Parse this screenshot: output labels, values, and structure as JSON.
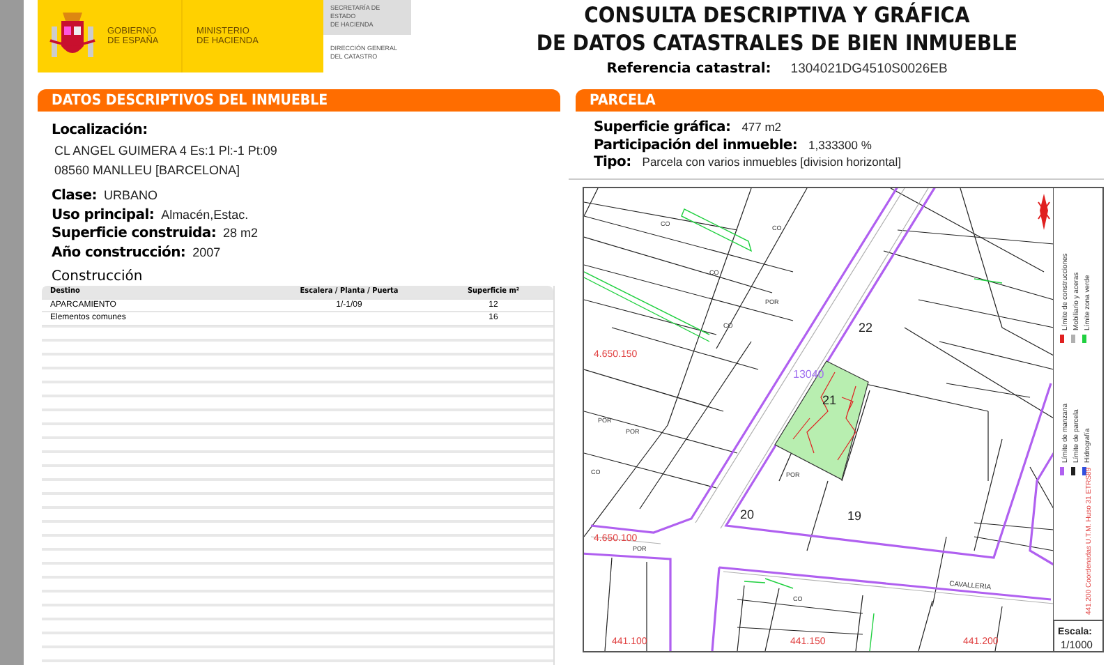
{
  "header": {
    "government_lines": [
      "GOBIERNO",
      "DE ESPAÑA"
    ],
    "ministry_lines": [
      "MINISTERIO",
      "DE HACIENDA"
    ],
    "secretariat_lines": [
      "SECRETARÍA DE ESTADO",
      "DE HACIENDA"
    ],
    "directorate_lines": [
      "DIRECCIÓN GENERAL",
      "DEL CATASTRO"
    ],
    "title_lines": [
      "CONSULTA DESCRIPTIVA Y GRÁFICA",
      "DE DATOS CATASTRALES DE BIEN INMUEBLE"
    ],
    "reference": {
      "label": "Referencia catastral:",
      "value": "1304021DG4510S0026EB"
    }
  },
  "property": {
    "title": "DATOS DESCRIPTIVOS DEL INMUEBLE",
    "location_label": "Localización:",
    "address_lines": [
      "CL ANGEL GUIMERA 4 Es:1 Pl:-1 Pt:09",
      "08560 MANLLEU [BARCELONA]"
    ],
    "fields": [
      {
        "label": "Clase:",
        "value": "URBANO"
      },
      {
        "label": "Uso principal:",
        "value": "Almacén,Estac."
      },
      {
        "label": "Superficie construida:",
        "value": "28 m2"
      },
      {
        "label": "Año construcción:",
        "value": "2007"
      }
    ],
    "construction": {
      "title": "Construcción",
      "columns": [
        "Destino",
        "Escalera / Planta / Puerta",
        "Superficie m²"
      ],
      "rows": [
        [
          "APARCAMIENTO",
          "1/-1/09",
          "12"
        ],
        [
          "Elementos comunes",
          "",
          "16"
        ]
      ]
    }
  },
  "parcel": {
    "title": "PARCELA",
    "fields": [
      {
        "label": "Superficie gráfica:",
        "value": "477 m2"
      },
      {
        "label": "Participación del inmueble:",
        "value": "1,333300 %"
      },
      {
        "label": "Tipo:",
        "value": "Parcela con varios inmuebles [division horizontal]"
      }
    ],
    "map": {
      "parcel_numbers": [
        "22",
        "21",
        "20",
        "19"
      ],
      "parcel_code": "13040",
      "street_name": "CAVALLERIA",
      "small_labels": [
        "CO",
        "CO",
        "CO",
        "POR",
        "CO",
        "POR",
        "POR",
        "CO",
        "POR",
        "POR",
        "CO"
      ],
      "y_coordinates": [
        "4.650.150",
        "4.650.100"
      ],
      "x_coordinates": [
        "441.100",
        "441.150",
        "441.200"
      ],
      "legend": [
        {
          "label": "Límite de manzana",
          "color": "#b060f0"
        },
        {
          "label": "Límite de construcciones",
          "color": "#e02020"
        },
        {
          "label": "Límite de parcela",
          "color": "#202020"
        },
        {
          "label": "Mobiliario y aceras",
          "color": "#b0b0b0"
        },
        {
          "label": "Hidrografía",
          "color": "#3050e0"
        },
        {
          "label": "Límite zona verde",
          "color": "#20d040"
        }
      ],
      "utm_note": "441.200 Coordenadas U.T.M. Huso 31 ETRS89",
      "scale_label": "Escala:",
      "scale_value": "1/1000"
    }
  }
}
